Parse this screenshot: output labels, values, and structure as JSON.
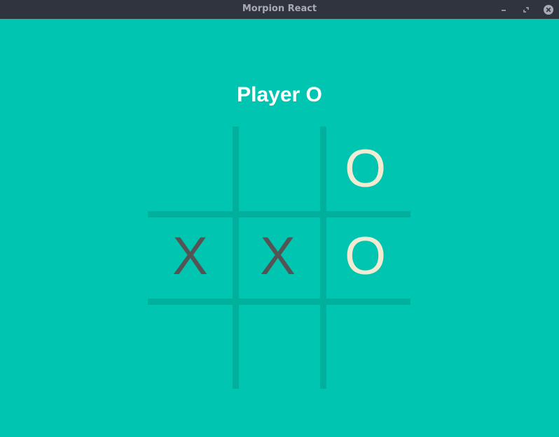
{
  "window": {
    "title": "Morpion React"
  },
  "titlebar_buttons": [
    {
      "name": "minimize",
      "icon": "minimize-icon"
    },
    {
      "name": "maximize",
      "icon": "maximize-icon"
    },
    {
      "name": "close",
      "icon": "close-icon"
    }
  ],
  "game": {
    "status": "Player O",
    "board": [
      "",
      "",
      "O",
      "X",
      "X",
      "O",
      "",
      "",
      ""
    ]
  },
  "colors": {
    "background": "#00c5b0",
    "grid_lines": "#00b09c",
    "titlebar": "#2f343f",
    "title_text": "#a9abb3",
    "x_mark": "#545454",
    "o_mark": "#f2ebd3",
    "status_text": "#ffffff"
  }
}
